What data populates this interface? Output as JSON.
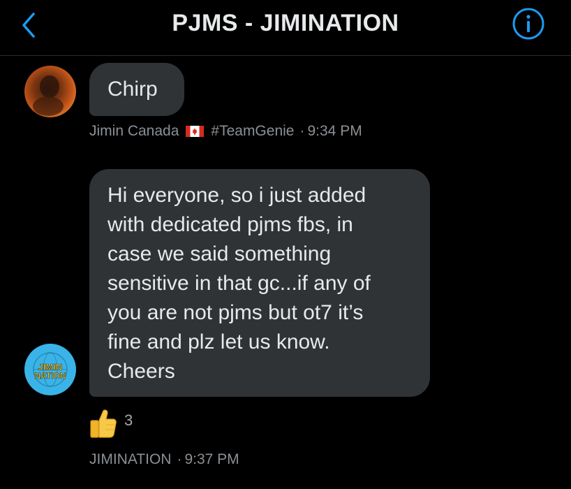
{
  "header": {
    "back_icon": "chevron-left-icon",
    "title": "PJMS - JIMINATION",
    "info_icon": "info-icon",
    "accent_color": "#1d9bf0"
  },
  "messages": [
    {
      "avatar": "user-avatar-jimin-canada",
      "text_lines": [
        "Chirp"
      ],
      "sender": "Jimin Canada",
      "flag_icon": "canada-flag-icon",
      "tag": "#TeamGenie",
      "time": "9:34 PM"
    },
    {
      "avatar": "user-avatar-jimination",
      "avatar_logo_lines": [
        "JIMIN",
        "NATION"
      ],
      "text_lines": [
        "Hi everyone, so i just added",
        "with dedicated pjms fbs, in",
        "case we said something",
        "sensitive in that gc...if any of",
        "you are not pjms but ot7 it’s",
        "fine and plz let us know.",
        "Cheers"
      ],
      "reaction": {
        "icon": "thumbs-up-icon",
        "count": "3"
      },
      "sender": "JIMINATION",
      "time": "9:37 PM"
    }
  ],
  "colors": {
    "background": "#000000",
    "bubble": "#2f3336",
    "text": "#e7e9ea",
    "meta": "#8b9095"
  }
}
